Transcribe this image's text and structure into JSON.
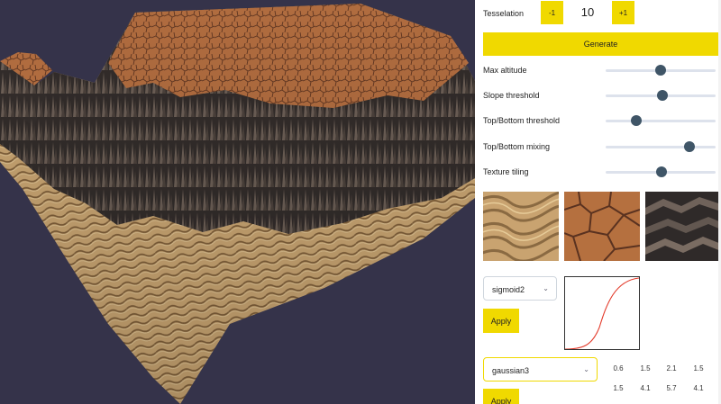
{
  "viewport": {
    "background": "#35334a",
    "sand_color": "#c7a16f",
    "dark_color": "#3b342f",
    "rust_color": "#a8683f"
  },
  "tesselation": {
    "label": "Tesselation",
    "minus_label": "-1",
    "value": "10",
    "plus_label": "+1"
  },
  "generate_label": "Generate",
  "accent": "#f0d900",
  "sliders": [
    {
      "label": "Max altitude",
      "value": 0.5
    },
    {
      "label": "Slope threshold",
      "value": 0.52
    },
    {
      "label": "Top/Bottom threshold",
      "value": 0.28
    },
    {
      "label": "Top/Bottom mixing",
      "value": 0.76
    },
    {
      "label": "Texture tiling",
      "value": 0.51
    }
  ],
  "textures": [
    {
      "name": "sand-ripple-texture"
    },
    {
      "name": "cracked-mud-texture"
    },
    {
      "name": "dark-rock-texture"
    }
  ],
  "curve_select": {
    "value": "sigmoid2",
    "apply_label": "Apply"
  },
  "gaussian_select": {
    "value": "gaussian3",
    "apply_label": "Apply"
  },
  "params_row1": [
    "0.6",
    "1.5",
    "2.1",
    "1.5"
  ],
  "params_row2": [
    "1.5",
    "4.1",
    "5.7",
    "4.1"
  ]
}
